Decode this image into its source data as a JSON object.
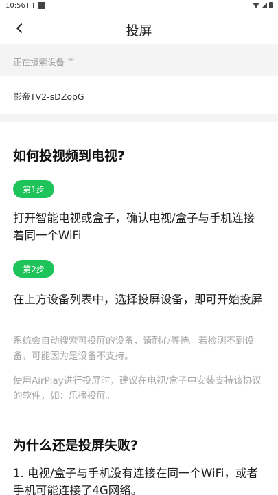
{
  "status_bar": {
    "time": "10:56"
  },
  "header": {
    "title": "投屏"
  },
  "search": {
    "status_text": "正在搜索设备"
  },
  "devices": [
    {
      "name": "影帝TV2-sDZopG"
    }
  ],
  "help": {
    "title": "如何投视频到电视?",
    "steps": [
      {
        "badge": "第1步",
        "text": "打开智能电视或盒子，确认电视/盒子与手机连接着同一个WiFi"
      },
      {
        "badge": "第2步",
        "text": "在上方设备列表中，选择投屏设备，即可开始投屏"
      }
    ],
    "notes": [
      "系统会自动搜索可投屏的设备，请耐心等待。若检测不到设备，可能因为是设备不支持。",
      "使用AirPlay进行投屏时，建议在电视/盒子中安装支持该协议的软件，如：乐播投屏。"
    ],
    "why_title": "为什么还是投屏失败?",
    "reasons": [
      "1. 电视/盒子与手机没有连接在同一个WiFi，或者手机可能连接了4G网络。"
    ]
  },
  "colors": {
    "accent": "#1ec35a",
    "muted_text": "#a6a6a6",
    "background": "#f4f4f4"
  },
  "icons": {
    "back": "chevron-left-icon",
    "loading": "spinner-icon"
  }
}
